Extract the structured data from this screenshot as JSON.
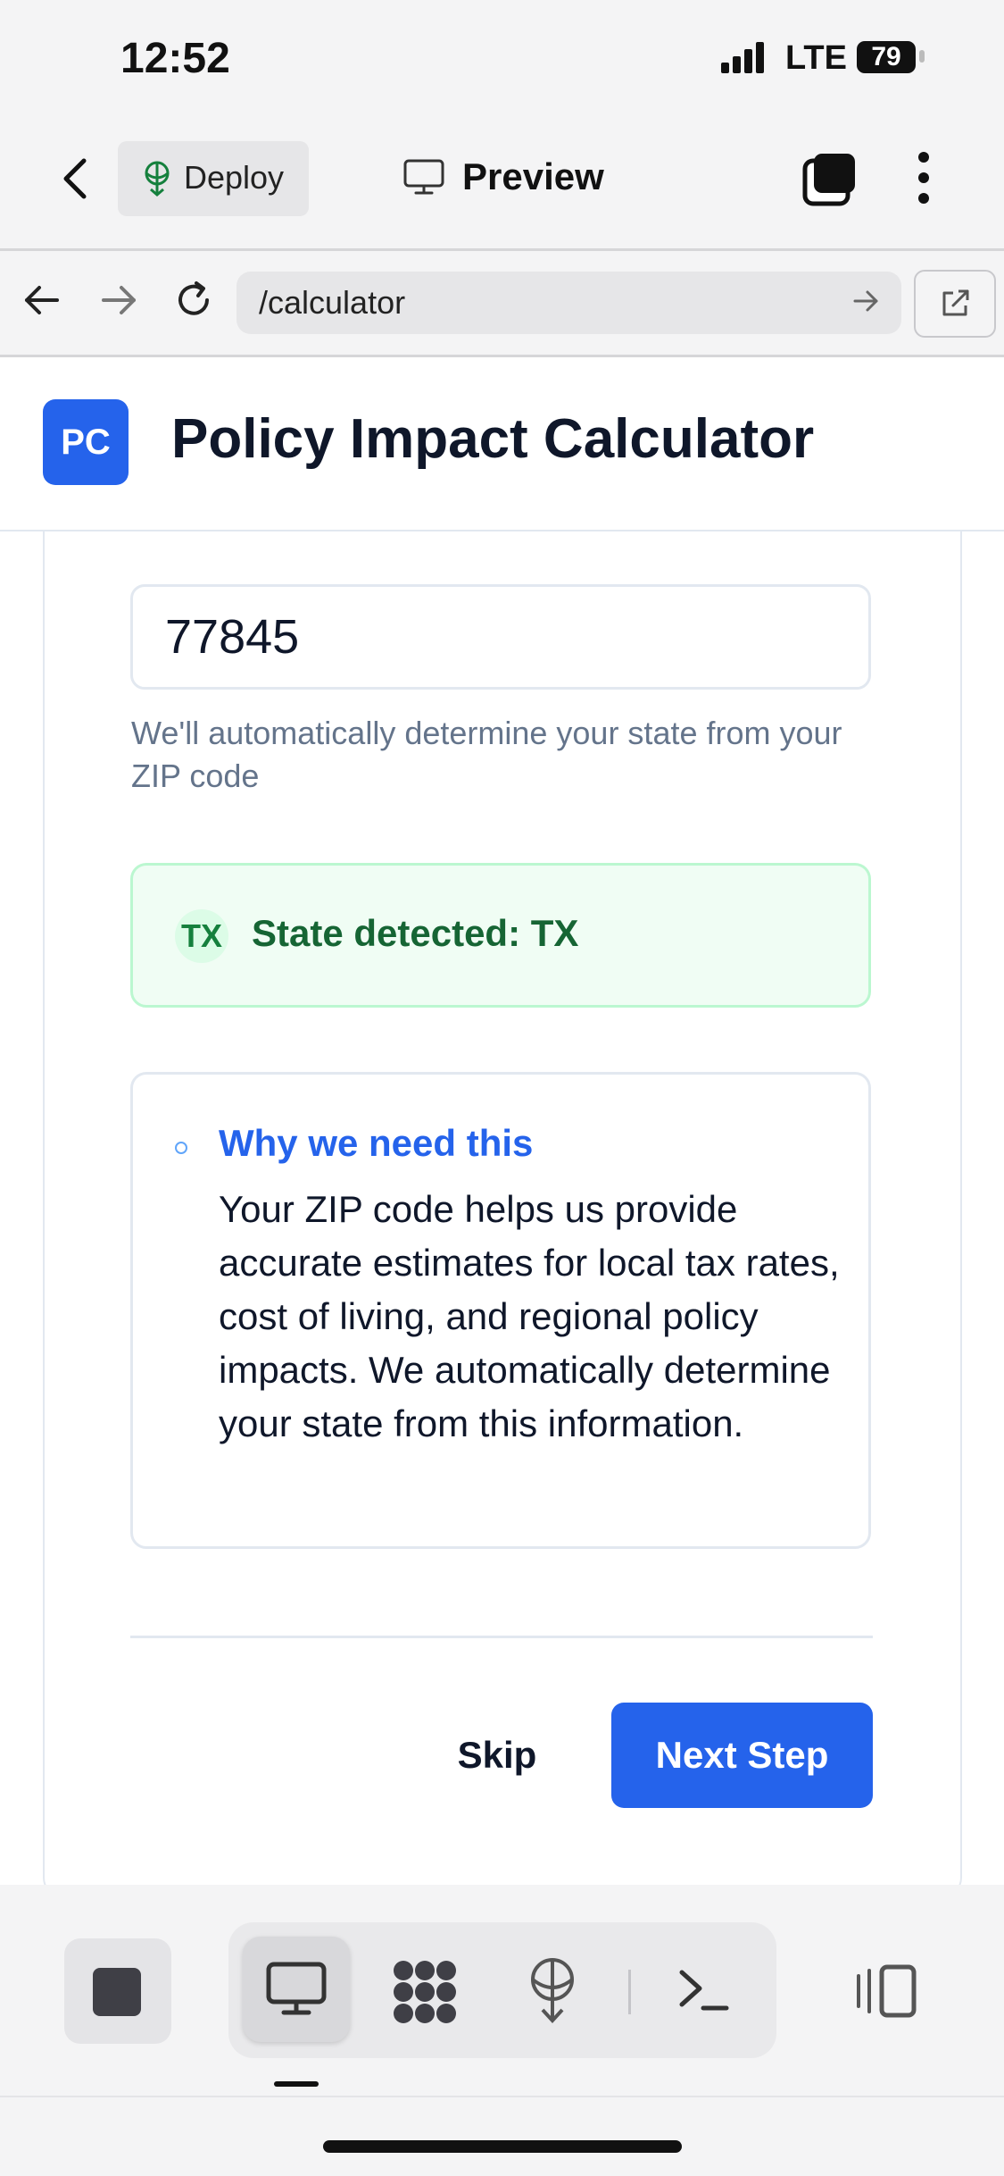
{
  "status_bar": {
    "time": "12:52",
    "network": "LTE",
    "battery": "79"
  },
  "app_bar": {
    "deploy_label": "Deploy",
    "preview_label": "Preview"
  },
  "browser": {
    "url": "/calculator"
  },
  "header": {
    "logo_text": "PC",
    "title": "Policy Impact Calculator"
  },
  "form": {
    "zip_value": "77845",
    "helper_text": "We'll automatically determine your state from your ZIP code",
    "state_badge": "TX",
    "state_detected": "State detected: TX",
    "info_title": "Why we need this",
    "info_body": "Your ZIP code helps us provide accurate estimates for local tax rates, cost of living, and regional policy impacts. We automatically determine your state from this information.",
    "skip_label": "Skip",
    "next_label": "Next Step"
  },
  "toolbar": {
    "items": [
      "stop-icon",
      "desktop-icon",
      "apps-icon",
      "deploy-icon",
      "terminal-icon",
      "panel-icon"
    ]
  },
  "colors": {
    "accent": "#2563eb",
    "success_bg": "#f0fdf4",
    "success_text": "#166534"
  }
}
